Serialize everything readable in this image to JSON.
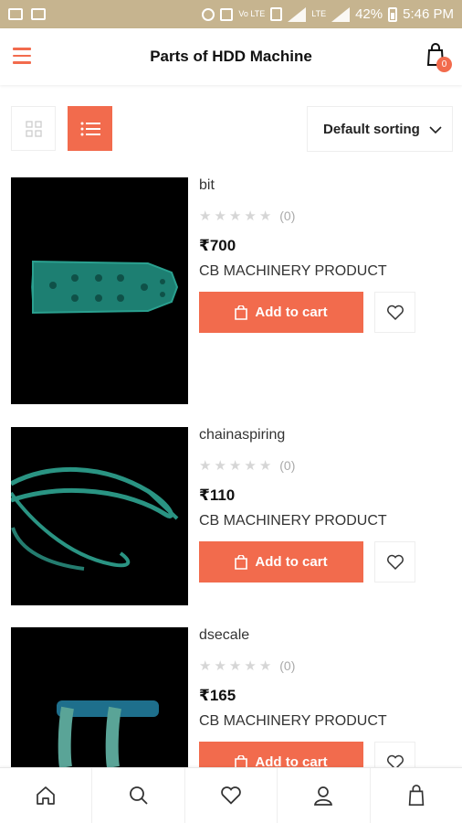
{
  "status_bar": {
    "battery": "42%",
    "time": "5:46 PM",
    "sim_label": "Vo\nLTE",
    "lte_label": "LTE"
  },
  "header": {
    "title": "Parts of HDD Machine",
    "cart_count": "0"
  },
  "toolbar": {
    "sort_label": "Default sorting"
  },
  "products": [
    {
      "name": "bit",
      "rating_count": "(0)",
      "price": "₹700",
      "brand": "CB MACHINERY PRODUCT",
      "add_to_cart": "Add to cart"
    },
    {
      "name": "chainaspiring",
      "rating_count": "(0)",
      "price": "₹110",
      "brand": "CB MACHINERY  PRODUCT",
      "add_to_cart": "Add to cart"
    },
    {
      "name": "dsecale",
      "rating_count": "(0)",
      "price": "₹165",
      "brand": "CB MACHINERY PRODUCT",
      "add_to_cart": "Add to cart"
    }
  ],
  "bottom_nav": [
    "home-icon",
    "search-icon",
    "heart-icon",
    "user-icon",
    "shopping-bag-icon"
  ],
  "colors": {
    "accent": "#f26b4d",
    "status_bar": "#c6b48f",
    "product_teal": "#1f8a7a"
  }
}
